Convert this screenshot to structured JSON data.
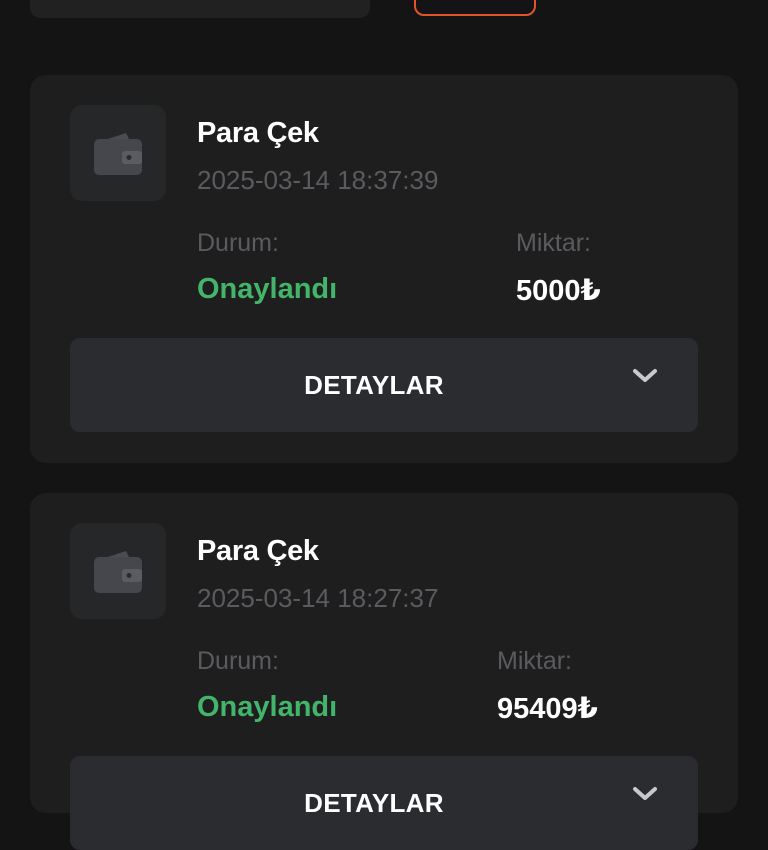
{
  "transactions": [
    {
      "icon": "wallet-icon",
      "title": "Para Çek",
      "timestamp": "2025-03-14 18:37:39",
      "status_label": "Durum:",
      "status_value": "Onaylandı",
      "amount_label": "Miktar:",
      "amount_value": "5000₺",
      "details_label": "DETAYLAR"
    },
    {
      "icon": "wallet-icon",
      "title": "Para Çek",
      "timestamp": "2025-03-14 18:27:37",
      "status_label": "Durum:",
      "status_value": "Onaylandı",
      "amount_label": "Miktar:",
      "amount_value": "95409₺",
      "details_label": "DETAYLAR"
    }
  ],
  "colors": {
    "background": "#141414",
    "card": "#1e1e1f",
    "status_approved": "#43b56a",
    "accent_border": "#e2552b"
  }
}
